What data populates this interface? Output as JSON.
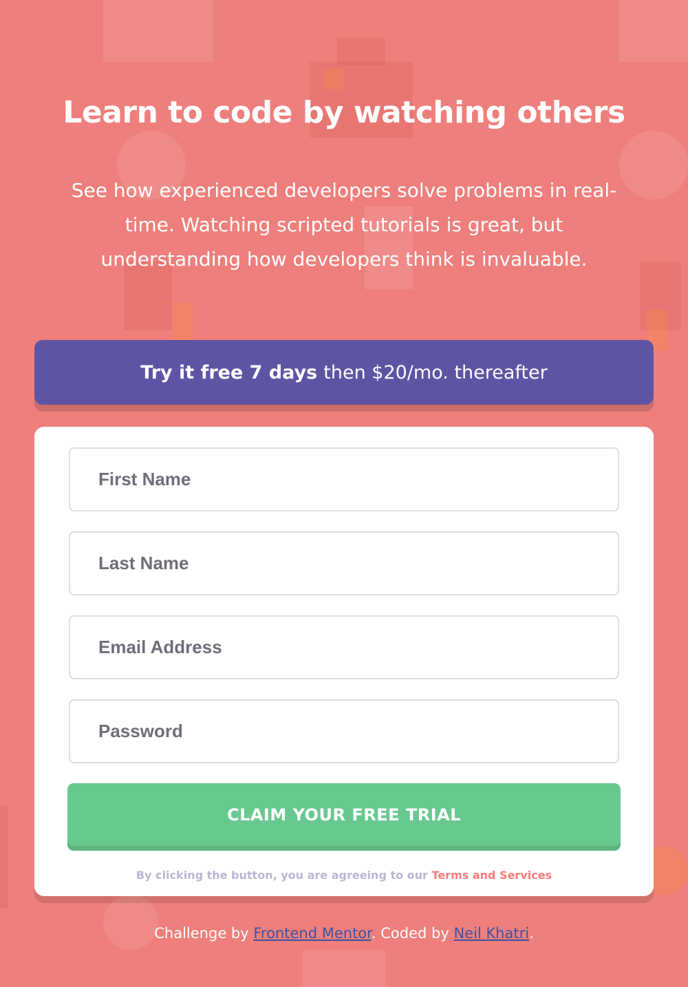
{
  "hero": {
    "headline": "Learn to code by watching others",
    "description": "See how experienced developers solve problems in real-time. Watching scripted tutorials is great, but understanding how developers think is invaluable."
  },
  "trial": {
    "bold": "Try it free 7 days",
    "rest": "then $20/mo. thereafter"
  },
  "form": {
    "first_name_placeholder": "First Name",
    "last_name_placeholder": "Last Name",
    "email_placeholder": "Email Address",
    "password_placeholder": "Password",
    "submit_label": "CLAIM YOUR FREE TRIAL",
    "terms_prefix": "By clicking the button, you are agreeing to our",
    "terms_link": "Terms and Services"
  },
  "footer": {
    "prefix": "Challenge by",
    "mentor_link": "Frontend Mentor",
    "middle": ". Coded by",
    "author_link": "Neil Khatri",
    "suffix": "."
  },
  "colors": {
    "background": "#ee7f7c",
    "banner": "#5e54a4",
    "button": "#68c990",
    "terms_link": "#ff7a7a",
    "footer_link": "#3e52a3"
  }
}
